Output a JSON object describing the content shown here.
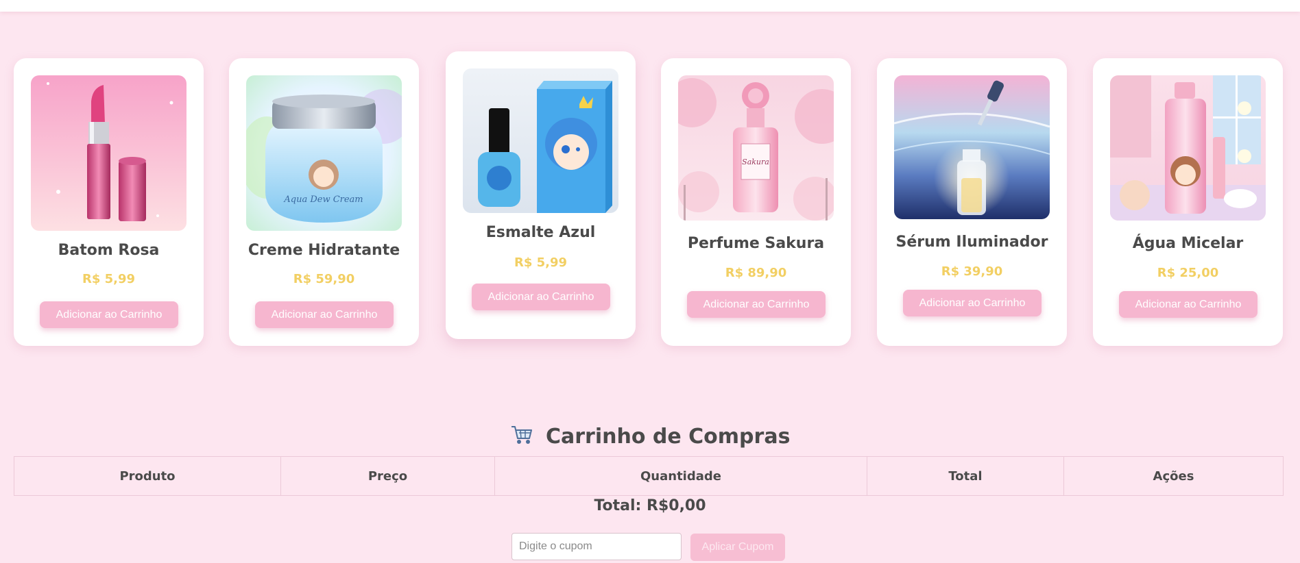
{
  "header": {
    "clipped_title": "·· ·· ·· ·· · ·· ·"
  },
  "products": [
    {
      "name": "Batom Rosa",
      "price": "R$ 5,99",
      "button": "Adicionar ao Carrinho",
      "image": "pink-lipstick-image"
    },
    {
      "name": "Creme Hidratante",
      "price": "R$ 59,90",
      "button": "Adicionar ao Carrinho",
      "image": "moisturizer-jar-image",
      "jar_label": "Aqua Dew Cream"
    },
    {
      "name": "Esmalte Azul",
      "price": "R$ 5,99",
      "button": "Adicionar ao Carrinho",
      "image": "blue-nail-polish-image"
    },
    {
      "name": "Perfume Sakura",
      "price": "R$ 89,90",
      "button": "Adicionar ao Carrinho",
      "image": "sakura-perfume-image",
      "bottle_label": "Sakura"
    },
    {
      "name": "Sérum Iluminador",
      "price": "R$ 39,90",
      "button": "Adicionar ao Carrinho",
      "image": "glow-serum-image"
    },
    {
      "name": "Água Micelar",
      "price": "R$ 25,00",
      "button": "Adicionar ao Carrinho",
      "image": "micellar-water-image"
    }
  ],
  "cart": {
    "title": "Carrinho de Compras",
    "icon": "shopping-cart-icon",
    "columns": [
      "Produto",
      "Preço",
      "Quantidade",
      "Total",
      "Ações"
    ],
    "rows": [],
    "total_text": "Total: R$0,00",
    "coupon_placeholder": "Digite o cupom",
    "coupon_button": "Aplicar Cupom"
  },
  "colors": {
    "background": "#fde6f0",
    "accent_pink": "#f6b6cf",
    "price_gold": "#f2cf63",
    "text_dark": "#4a4a4a"
  }
}
